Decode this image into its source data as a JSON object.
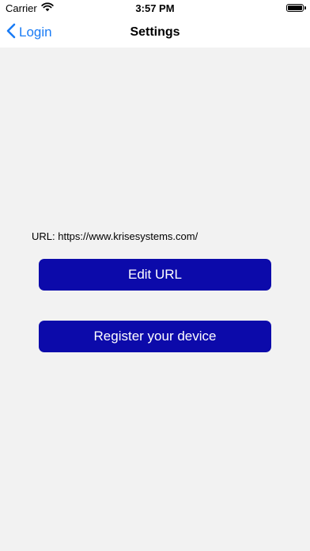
{
  "status_bar": {
    "carrier": "Carrier",
    "time": "3:57 PM"
  },
  "nav": {
    "back_label": "Login",
    "title": "Settings"
  },
  "settings": {
    "url_line": "URL: https://www.krisesystems.com/",
    "edit_url_label": "Edit URL",
    "register_label": "Register your device"
  },
  "colors": {
    "accent": "#1a7cf5",
    "button_bg": "#0c0aaa",
    "background": "#f2f2f2"
  },
  "icons": {
    "wifi": "wifi-icon",
    "battery": "battery-icon",
    "back": "chevron-left-icon"
  }
}
